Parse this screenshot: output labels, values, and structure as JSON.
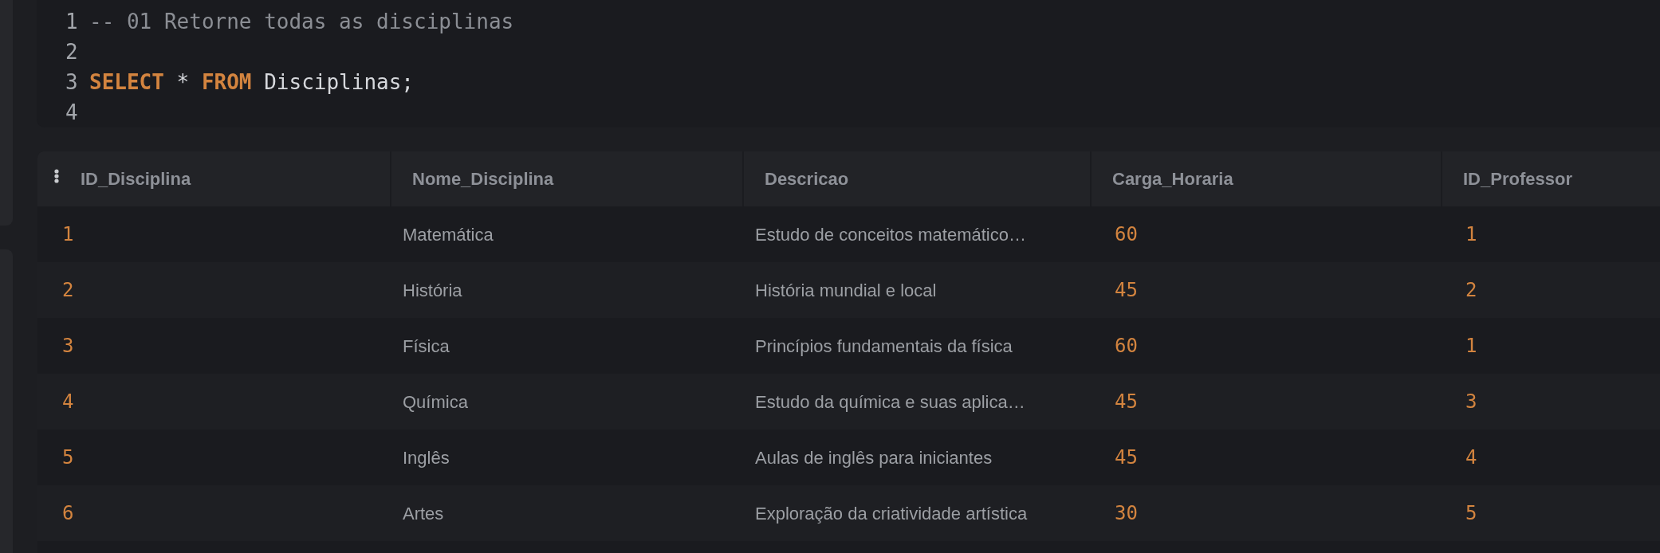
{
  "editor": {
    "lines": [
      {
        "number": "1",
        "tokens": [
          {
            "kind": "comment",
            "text": "-- 01 Retorne todas as disciplinas"
          }
        ]
      },
      {
        "number": "2"
      },
      {
        "number": "3",
        "tokens": [
          {
            "kind": "keyword",
            "text": "SELECT"
          },
          {
            "kind": "plain",
            "text": " * "
          },
          {
            "kind": "keyword",
            "text": "FROM"
          },
          {
            "kind": "plain",
            "text": " Disciplinas;"
          }
        ]
      },
      {
        "number": "4"
      }
    ]
  },
  "results": {
    "columns": [
      {
        "label": "ID_Disciplina",
        "kind": "number"
      },
      {
        "label": "Nome_Disciplina",
        "kind": "text"
      },
      {
        "label": "Descricao",
        "kind": "text"
      },
      {
        "label": "Carga_Horaria",
        "kind": "number"
      },
      {
        "label": "ID_Professor",
        "kind": "number"
      }
    ],
    "rows": [
      [
        "1",
        "Matemática",
        "Estudo de conceitos matemático…",
        "60",
        "1"
      ],
      [
        "2",
        "História",
        "História mundial e local",
        "45",
        "2"
      ],
      [
        "3",
        "Física",
        "Princípios fundamentais da física",
        "60",
        "1"
      ],
      [
        "4",
        "Química",
        "Estudo da química e suas aplica…",
        "45",
        "3"
      ],
      [
        "5",
        "Inglês",
        "Aulas de inglês para iniciantes",
        "45",
        "4"
      ],
      [
        "6",
        "Artes",
        "Exploração da criatividade artística",
        "30",
        "5"
      ]
    ]
  }
}
